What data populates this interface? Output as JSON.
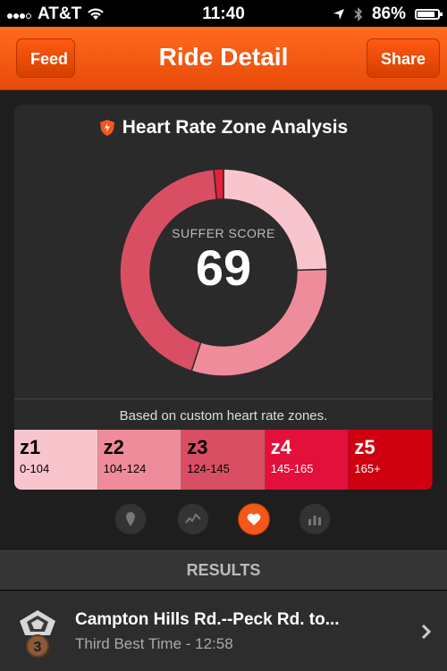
{
  "status": {
    "carrier": "AT&T",
    "time": "11:40",
    "battery": "86%"
  },
  "nav": {
    "title": "Ride Detail",
    "back_label": "Feed",
    "share_label": "Share"
  },
  "card": {
    "title": "Heart Rate Zone Analysis",
    "score_label": "SUFFER SCORE",
    "score": "69",
    "note": "Based on custom heart rate zones."
  },
  "chart_data": {
    "type": "pie",
    "segments": [
      {
        "zone": "z1",
        "fraction": 0.245,
        "color": "#f9c5cd"
      },
      {
        "zone": "z2",
        "fraction": 0.305,
        "color": "#ef8c9b"
      },
      {
        "zone": "z3",
        "fraction": 0.435,
        "color": "#d84f63"
      },
      {
        "zone": "z4",
        "fraction": 0.015,
        "color": "#e2213c"
      },
      {
        "zone": "z5",
        "fraction": 0.0,
        "color": "#cf0b1b"
      }
    ]
  },
  "zones": [
    {
      "name": "z1",
      "range": "0-104",
      "color": "#f9c5cd",
      "text": "#000000"
    },
    {
      "name": "z2",
      "range": "104-124",
      "color": "#ef8c9b",
      "text": "#000000"
    },
    {
      "name": "z3",
      "range": "124-145",
      "color": "#d84f63",
      "text": "#000000"
    },
    {
      "name": "z4",
      "range": "145-165",
      "color": "#e2103a",
      "text": "#ffffff"
    },
    {
      "name": "z5",
      "range": "165+",
      "color": "#cf0010",
      "text": "#ffffff"
    }
  ],
  "tabs": [
    {
      "name": "tab-map",
      "icon": "map-pin-icon",
      "active": false
    },
    {
      "name": "tab-analysis",
      "icon": "graph-icon",
      "active": false
    },
    {
      "name": "tab-heart-rate",
      "icon": "heart-icon",
      "active": true
    },
    {
      "name": "tab-splits",
      "icon": "bar-chart-icon",
      "active": false
    }
  ],
  "results": {
    "header": "RESULTS",
    "item": {
      "title": "Campton Hills Rd.--Peck Rd. to...",
      "subtitle": "Third Best Time - 12:58",
      "medal_rank": "3"
    }
  },
  "colors": {
    "accent": "#f4571a"
  }
}
